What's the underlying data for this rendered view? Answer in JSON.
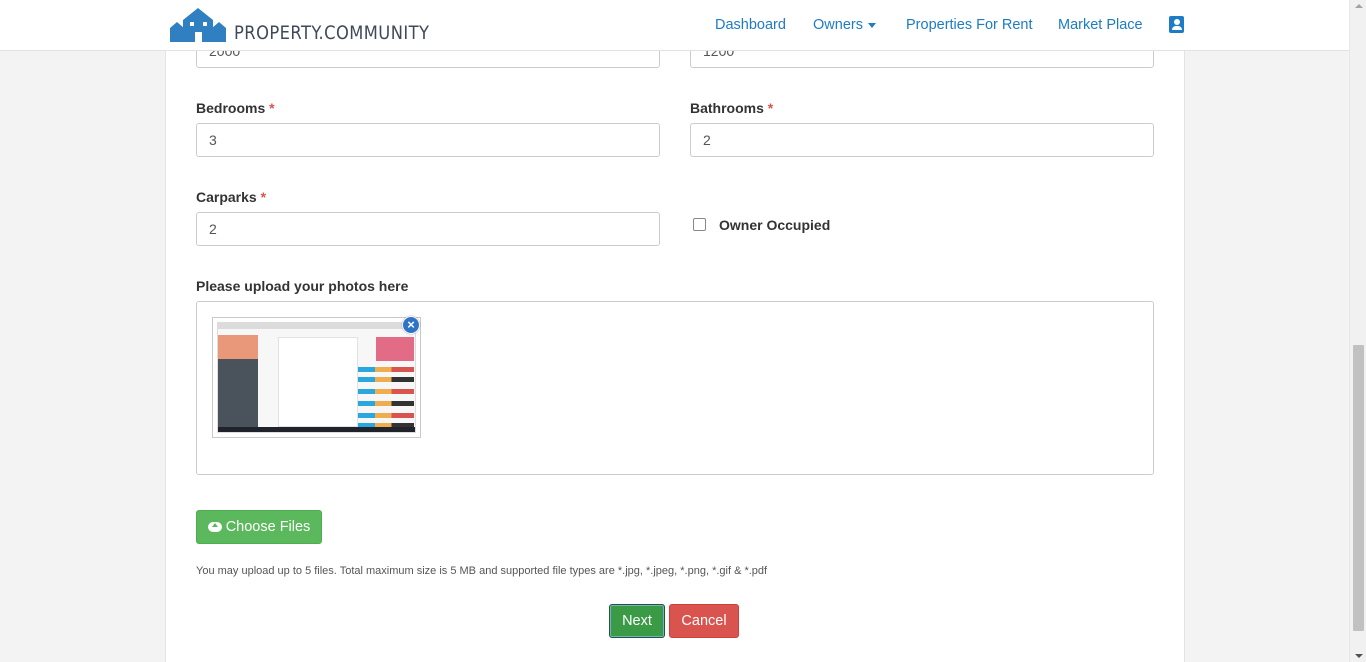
{
  "brand": {
    "name": "PROPERTY.COMMUNITY"
  },
  "nav": {
    "dashboard": "Dashboard",
    "owners": "Owners",
    "properties_for_rent": "Properties For Rent",
    "market_place": "Market Place",
    "profile_icon": "user-card-icon"
  },
  "form": {
    "top_left_value": "2000",
    "top_right_value": "1200",
    "bedrooms": {
      "label": "Bedrooms",
      "required": "*",
      "value": "3"
    },
    "bathrooms": {
      "label": "Bathrooms",
      "required": "*",
      "value": "2"
    },
    "carparks": {
      "label": "Carparks",
      "required": "*",
      "value": "2"
    },
    "owner_occupied": {
      "label": "Owner Occupied",
      "checked": false
    },
    "upload": {
      "label": "Please upload your photos here",
      "remove_symbol": "×",
      "choose_files": "Choose Files",
      "help": "You may upload up to 5 files. Total maximum size is 5 MB and supported file types are *.jpg, *.jpeg, *.png, *.gif & *.pdf"
    },
    "next": "Next",
    "cancel": "Cancel"
  },
  "colors": {
    "link": "#1d7cc3",
    "success": "#5cb85c",
    "danger": "#d9534f",
    "required": "#d9534f"
  }
}
